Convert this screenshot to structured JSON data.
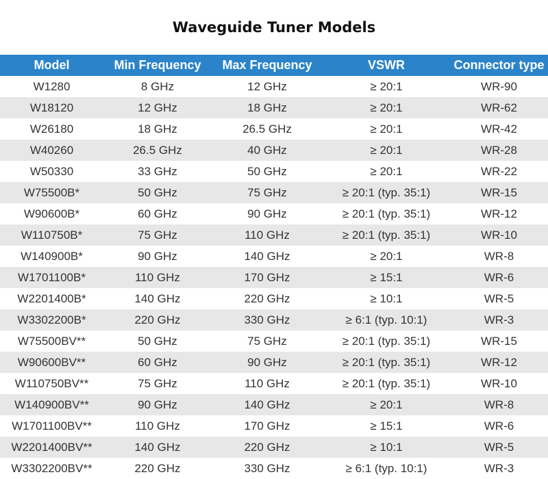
{
  "title": "Waveguide Tuner Models",
  "colors": {
    "header_bg": "#2b84c9",
    "header_text": "#ffffff",
    "row_alt": "#e7e7e7",
    "row_text": "#333333"
  },
  "table": {
    "headers": [
      "Model",
      "Min Frequency",
      "Max Frequency",
      "VSWR",
      "Connector type"
    ],
    "rows": [
      [
        "W1280",
        "8 GHz",
        "12 GHz",
        "≥ 20:1",
        "WR-90"
      ],
      [
        "W18120",
        "12 GHz",
        "18 GHz",
        "≥ 20:1",
        "WR-62"
      ],
      [
        "W26180",
        "18 GHz",
        "26.5 GHz",
        "≥ 20:1",
        "WR-42"
      ],
      [
        "W40260",
        "26.5 GHz",
        "40 GHz",
        "≥ 20:1",
        "WR-28"
      ],
      [
        "W50330",
        "33 GHz",
        "50 GHz",
        "≥ 20:1",
        "WR-22"
      ],
      [
        "W75500B*",
        "50 GHz",
        "75 GHz",
        "≥ 20:1 (typ. 35:1)",
        "WR-15"
      ],
      [
        "W90600B*",
        "60 GHz",
        "90 GHz",
        "≥ 20:1 (typ. 35:1)",
        "WR-12"
      ],
      [
        "W110750B*",
        "75 GHz",
        "110 GHz",
        "≥ 20:1 (typ. 35:1)",
        "WR-10"
      ],
      [
        "W140900B*",
        "90 GHz",
        "140 GHz",
        "≥ 20:1",
        "WR-8"
      ],
      [
        "W1701100B*",
        "110 GHz",
        "170 GHz",
        "≥ 15:1",
        "WR-6"
      ],
      [
        "W2201400B*",
        "140 GHz",
        "220 GHz",
        "≥ 10:1",
        "WR-5"
      ],
      [
        "W3302200B*",
        "220 GHz",
        "330 GHz",
        "≥ 6:1 (typ. 10:1)",
        "WR-3"
      ],
      [
        "W75500BV**",
        "50 GHz",
        "75 GHz",
        "≥ 20:1 (typ. 35:1)",
        "WR-15"
      ],
      [
        "W90600BV**",
        "60 GHz",
        "90 GHz",
        "≥ 20:1 (typ. 35:1)",
        "WR-12"
      ],
      [
        "W110750BV**",
        "75 GHz",
        "110 GHz",
        "≥ 20:1 (typ. 35:1)",
        "WR-10"
      ],
      [
        "W140900BV**",
        "90 GHz",
        "140 GHz",
        "≥ 20:1",
        "WR-8"
      ],
      [
        "W1701100BV**",
        "110 GHz",
        "170 GHz",
        "≥ 15:1",
        "WR-6"
      ],
      [
        "W2201400BV**",
        "140 GHz",
        "220 GHz",
        "≥ 10:1",
        "WR-5"
      ],
      [
        "W3302200BV**",
        "220 GHz",
        "330 GHz",
        "≥ 6:1 (typ. 10:1)",
        "WR-3"
      ]
    ]
  }
}
